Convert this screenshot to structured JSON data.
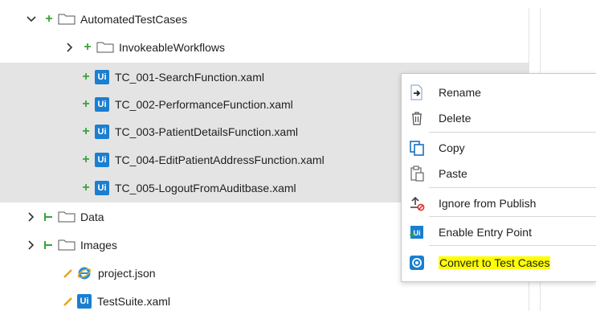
{
  "tree": {
    "rows": [
      {
        "label": "AutomatedTestCases"
      },
      {
        "label": "InvokeableWorkflows"
      },
      {
        "label": "TC_001-SearchFunction.xaml"
      },
      {
        "label": "TC_002-PerformanceFunction.xaml"
      },
      {
        "label": "TC_003-PatientDetailsFunction.xaml"
      },
      {
        "label": "TC_004-EditPatientAddressFunction.xaml"
      },
      {
        "label": "TC_005-LogoutFromAuditbase.xaml"
      },
      {
        "label": "Data"
      },
      {
        "label": "Images"
      },
      {
        "label": "project.json"
      },
      {
        "label": "TestSuite.xaml"
      }
    ],
    "ui_badge": "Ui"
  },
  "context_menu": {
    "items": [
      {
        "label": "Rename",
        "icon": "rename-icon"
      },
      {
        "label": "Delete",
        "icon": "trash-icon"
      },
      {
        "label": "Copy",
        "icon": "copy-icon"
      },
      {
        "label": "Paste",
        "icon": "paste-icon"
      },
      {
        "label": "Ignore from Publish",
        "icon": "ignore-publish-icon"
      },
      {
        "label": "Enable Entry Point",
        "icon": "entry-point-icon"
      },
      {
        "label": "Convert to Test Cases",
        "icon": "convert-test-case-icon",
        "highlight": "#ffff00"
      }
    ]
  },
  "colors": {
    "selection": "#e4e4e4",
    "plus": "#3aa33a",
    "ui_blue": "#1a7fd1",
    "highlight": "#ffff00"
  }
}
